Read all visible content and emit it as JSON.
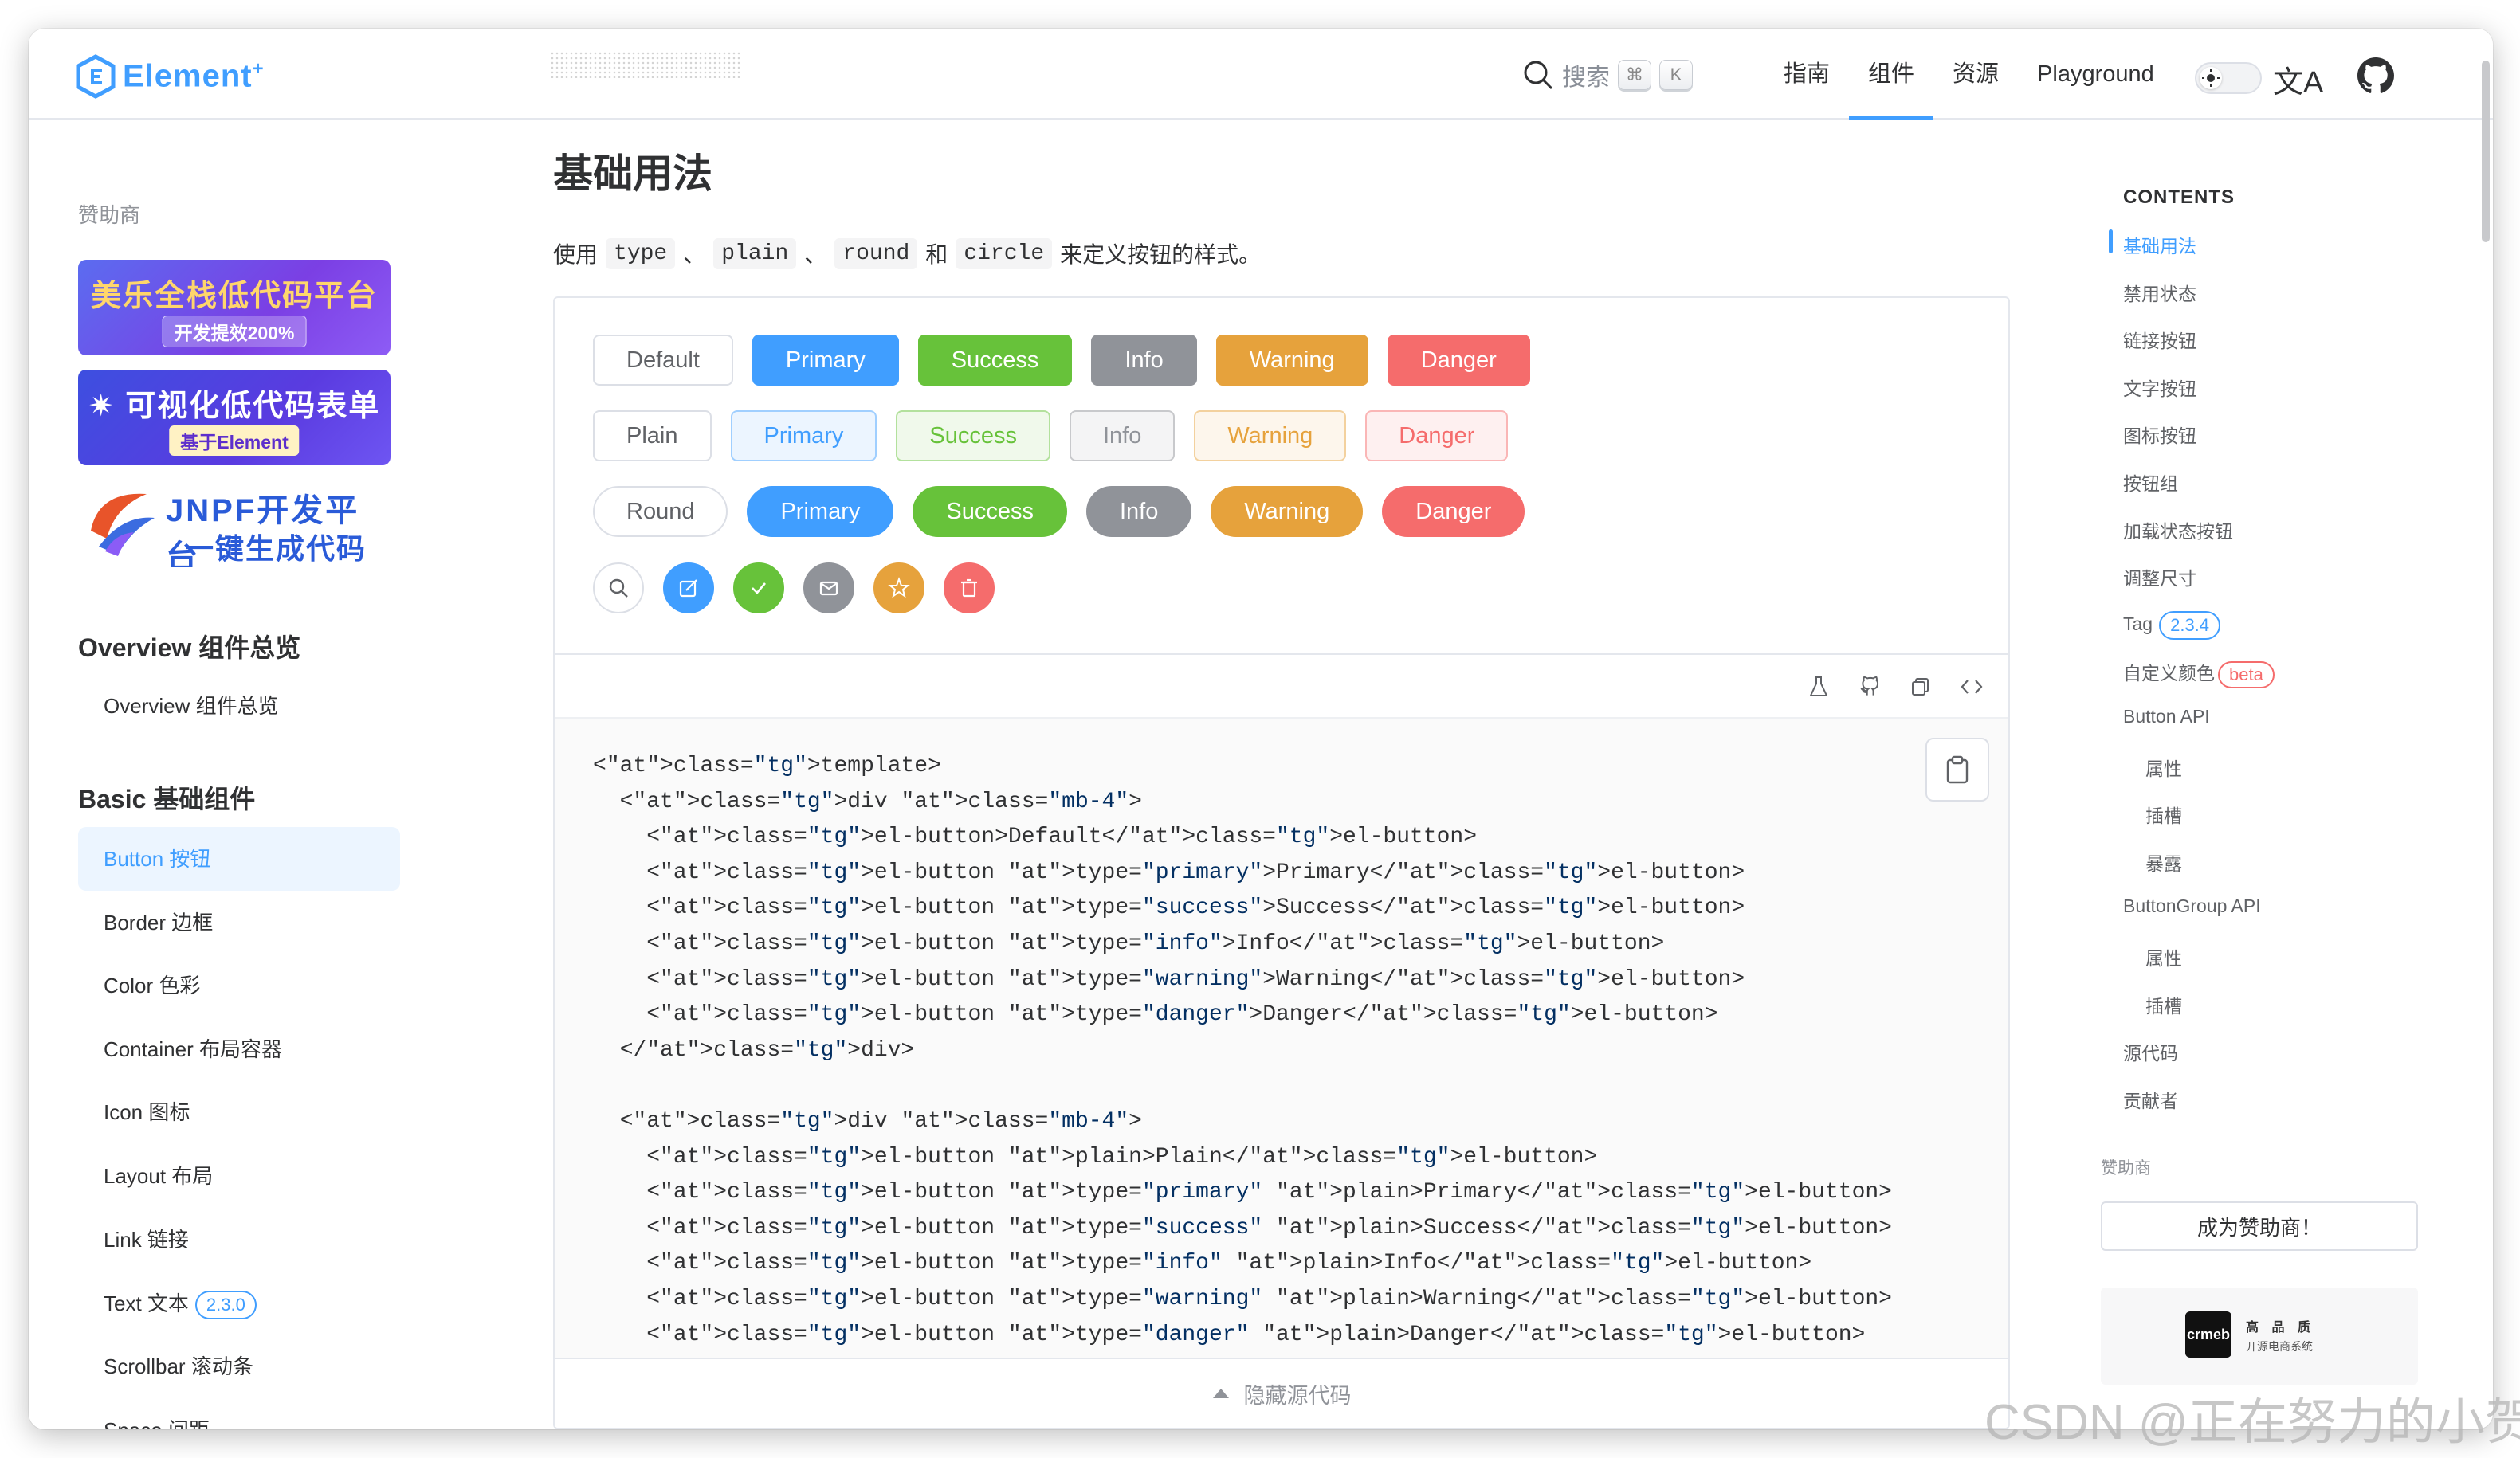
{
  "header": {
    "logo_text": "Element",
    "logo_plus": "+",
    "search_label": "搜索",
    "search_kbd_1": "⌘",
    "search_kbd_2": "K",
    "nav": [
      "指南",
      "组件",
      "资源",
      "Playground"
    ],
    "active_nav": "组件",
    "lang_icon": "文A"
  },
  "sidebar": {
    "sponsor_label": "赞助商",
    "banner1_big": "美乐全栈低代码平台",
    "banner1_pill": "开发提效200%",
    "banner2_big": "✷ 可视化低代码表单",
    "banner2_pill": "基于Element",
    "banner3_line1": "JNPF开发平台",
    "banner3_line2": "一键生成代码",
    "group1_title": "Overview 组件总览",
    "group1_items": [
      "Overview 组件总览"
    ],
    "group2_title": "Basic 基础组件",
    "group2_items": [
      "Button 按钮",
      "Border 边框",
      "Color 色彩",
      "Container 布局容器",
      "Icon 图标",
      "Layout 布局",
      "Link 链接",
      "Text 文本",
      "Scrollbar 滚动条",
      "Space 间距"
    ],
    "text_version": "2.3.0",
    "active_item": "Button 按钮"
  },
  "main": {
    "title": "基础用法",
    "desc_prefix": "使用",
    "desc_codes": [
      "type",
      "plain",
      "round",
      "circle"
    ],
    "desc_sep1": "、",
    "desc_sep2": "、",
    "desc_and": "和",
    "desc_suffix": "来定义按钮的样式。",
    "row_default": [
      "Default",
      "Primary",
      "Success",
      "Info",
      "Warning",
      "Danger"
    ],
    "row_plain": [
      "Plain",
      "Primary",
      "Success",
      "Info",
      "Warning",
      "Danger"
    ],
    "row_round": [
      "Round",
      "Primary",
      "Success",
      "Info",
      "Warning",
      "Danger"
    ],
    "circle_icons": [
      "search-icon",
      "edit-icon",
      "check-icon",
      "message-icon",
      "star-icon",
      "delete-icon"
    ],
    "hide_code_label": "隐藏源代码",
    "code_lines": [
      "<template>",
      "  <div class=\"mb-4\">",
      "    <el-button>Default</el-button>",
      "    <el-button type=\"primary\">Primary</el-button>",
      "    <el-button type=\"success\">Success</el-button>",
      "    <el-button type=\"info\">Info</el-button>",
      "    <el-button type=\"warning\">Warning</el-button>",
      "    <el-button type=\"danger\">Danger</el-button>",
      "  </div>",
      "",
      "  <div class=\"mb-4\">",
      "    <el-button plain>Plain</el-button>",
      "    <el-button type=\"primary\" plain>Primary</el-button>",
      "    <el-button type=\"success\" plain>Success</el-button>",
      "    <el-button type=\"info\" plain>Info</el-button>",
      "    <el-button type=\"warning\" plain>Warning</el-button>",
      "    <el-button type=\"danger\" plain>Danger</el-button>"
    ]
  },
  "toc": {
    "heading": "CONTENTS",
    "items": [
      {
        "label": "基础用法",
        "level": 1,
        "active": true
      },
      {
        "label": "禁用状态",
        "level": 1
      },
      {
        "label": "链接按钮",
        "level": 1
      },
      {
        "label": "文字按钮",
        "level": 1
      },
      {
        "label": "图标按钮",
        "level": 1
      },
      {
        "label": "按钮组",
        "level": 1
      },
      {
        "label": "加载状态按钮",
        "level": 1
      },
      {
        "label": "调整尺寸",
        "level": 1
      },
      {
        "label": "Tag",
        "level": 1,
        "badge": "2.3.4",
        "badge_type": "version"
      },
      {
        "label": "自定义颜色",
        "level": 1,
        "badge": "beta",
        "badge_type": "beta"
      },
      {
        "label": "Button API",
        "level": 1
      },
      {
        "label": "属性",
        "level": 2
      },
      {
        "label": "插槽",
        "level": 2
      },
      {
        "label": "暴露",
        "level": 2
      },
      {
        "label": "ButtonGroup API",
        "level": 1
      },
      {
        "label": "属性",
        "level": 2
      },
      {
        "label": "插槽",
        "level": 2
      },
      {
        "label": "源代码",
        "level": 1
      },
      {
        "label": "贡献者",
        "level": 1
      }
    ],
    "sponsor_label": "赞助商",
    "become_sponsor": "成为赞助商！",
    "crmeb_logo": "crmeb",
    "crmeb_line1": "高 品 质",
    "crmeb_line2": "开源电商系统"
  },
  "watermark": "CSDN @正在努力的小贺",
  "colors": {
    "primary": "#409eff",
    "success": "#67c23a",
    "info": "#909399",
    "warning": "#e6a23c",
    "danger": "#f56c6c"
  }
}
